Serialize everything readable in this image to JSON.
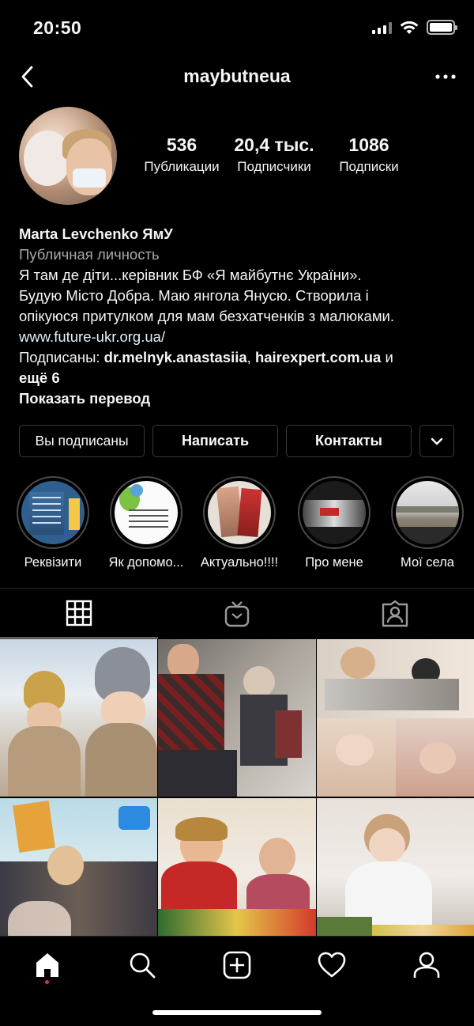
{
  "status_bar": {
    "time": "20:50"
  },
  "header": {
    "username": "maybutneua"
  },
  "profile": {
    "stats": [
      {
        "value": "536",
        "label": "Публикации"
      },
      {
        "value": "20,4 тыс.",
        "label": "Подписчики"
      },
      {
        "value": "1086",
        "label": "Подписки"
      }
    ],
    "name": "Marta Levchenko ЯмУ",
    "category": "Публичная личность",
    "bio_lines": [
      "Я там де діти...керівник БФ «Я майбутнє України».",
      "Будую Місто Добра. Маю янгола Янусю. Створила і",
      "опікуюся притулком для мам безхатченків з малюками."
    ],
    "website": "www.future-ukr.org.ua/",
    "followed_by": {
      "prefix": "Подписаны: ",
      "user1": "dr.melnyk.anastasiia",
      "sep": ", ",
      "user2": "hairexpert.com.ua",
      "suffix": " и",
      "more": "ещё 6"
    },
    "translate": "Показать перевод"
  },
  "actions": {
    "following": "Вы подписаны",
    "message": "Написать",
    "contacts": "Контакты"
  },
  "highlights": [
    {
      "label": "Реквізити"
    },
    {
      "label": "Як допомо..."
    },
    {
      "label": "Актуально!!!!"
    },
    {
      "label": "Про мене"
    },
    {
      "label": "Мої села"
    }
  ],
  "tabs": [
    "grid-icon",
    "igtv-icon",
    "tagged-icon"
  ],
  "bottom_nav": [
    "home-icon",
    "search-icon",
    "new-post-icon",
    "activity-icon",
    "profile-icon"
  ],
  "colors": {
    "background": "#000000",
    "link": "#e0f1ff",
    "secondary_text": "#a8a8a8",
    "notification_dot": "#e0302f"
  }
}
